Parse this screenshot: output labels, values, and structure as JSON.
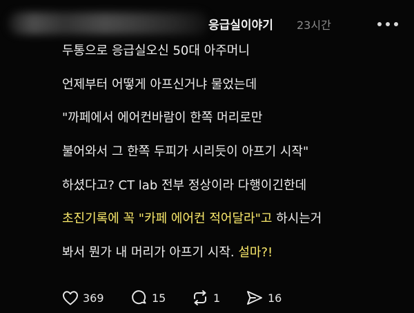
{
  "post": {
    "username": "응급실이야기",
    "time": "23시간",
    "lines": [
      {
        "parts": [
          {
            "text": "두통으로 응급실오신 50대 아주머니",
            "highlight": false
          }
        ]
      },
      {
        "parts": [
          {
            "text": "언제부터 어떻게 아프신거냐 물었는데",
            "highlight": false
          }
        ]
      },
      {
        "parts": [
          {
            "text": "\"까페에서 에어컨바람이 한쪽 머리로만",
            "highlight": false
          }
        ]
      },
      {
        "parts": [
          {
            "text": "불어와서 그 한쪽 두피가 시리듯이 아프기 시작\"",
            "highlight": false
          }
        ]
      },
      {
        "parts": [
          {
            "text": "하셨다고? CT lab 전부 정상이라 다행이긴한데",
            "highlight": false
          }
        ]
      },
      {
        "parts": [
          {
            "text": "초진기록에 꼭 \"카페 에어컨 적어달라\"고",
            "highlight": true
          },
          {
            "text": " 하시는거",
            "highlight": false
          }
        ]
      },
      {
        "parts": [
          {
            "text": "봐서 뭔가 내 머리가 아프기 시작. ",
            "highlight": false
          },
          {
            "text": "설마?!",
            "highlight": true
          }
        ]
      }
    ],
    "actions": {
      "likes": "369",
      "comments": "15",
      "reposts": "1",
      "shares": "16"
    }
  },
  "colors": {
    "background": "#060606",
    "text": "#eeeeee",
    "highlight": "#fae96b",
    "muted": "#8c8c8c"
  },
  "icons": {
    "more": "more-horizontal-icon",
    "like": "heart-icon",
    "comment": "comment-bubble-icon",
    "repost": "repost-arrows-icon",
    "share": "send-icon"
  }
}
